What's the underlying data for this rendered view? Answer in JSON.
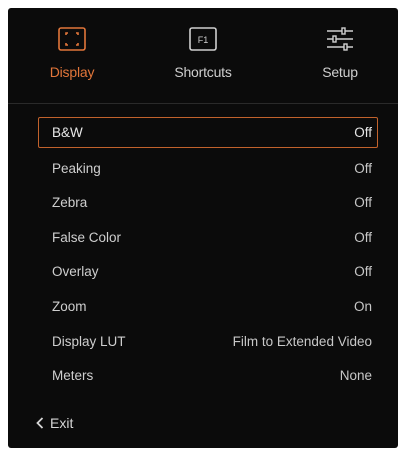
{
  "tabs": [
    {
      "label": "Display",
      "icon": "display-focus-icon",
      "active": true
    },
    {
      "label": "Shortcuts",
      "icon": "f1-key-icon",
      "active": false
    },
    {
      "label": "Setup",
      "icon": "sliders-icon",
      "active": false
    }
  ],
  "settings": [
    {
      "label": "B&W",
      "value": "Off",
      "selected": true
    },
    {
      "label": "Peaking",
      "value": "Off"
    },
    {
      "label": "Zebra",
      "value": "Off"
    },
    {
      "label": "False Color",
      "value": "Off"
    },
    {
      "label": "Overlay",
      "value": "Off"
    },
    {
      "label": "Zoom",
      "value": "On"
    },
    {
      "label": "Display LUT",
      "value": "Film to Extended Video"
    },
    {
      "label": "Meters",
      "value": "None"
    }
  ],
  "f1_key_text": "F1",
  "exit_label": "Exit",
  "colors": {
    "accent": "#e2763a",
    "selection_border": "#c2622c",
    "background": "#0b0b0b",
    "text": "#cfcfcf"
  }
}
